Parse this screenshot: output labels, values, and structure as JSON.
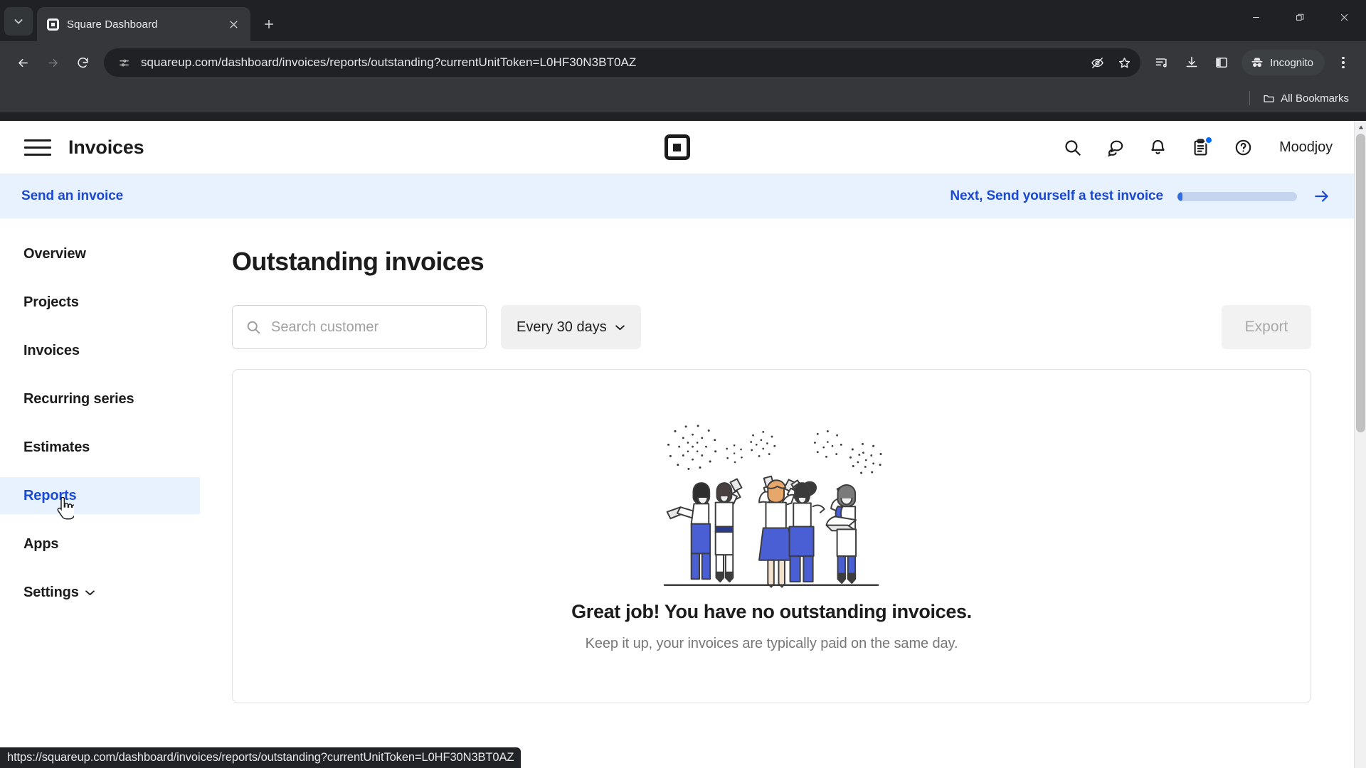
{
  "browser": {
    "tab": {
      "title": "Square Dashboard",
      "favicon": "square-logo-icon"
    },
    "tab_search_tooltip": "Search tabs",
    "new_tab_label": "New tab",
    "url": "squareup.com/dashboard/invoices/reports/outstanding?currentUnitToken=L0HF30N3BT0AZ",
    "profile_label": "Incognito",
    "bookmarks_label": "All Bookmarks",
    "status_url": "https://squareup.com/dashboard/invoices/reports/outstanding?currentUnitToken=L0HF30N3BT0AZ",
    "icons": {
      "back": "back-arrow-icon",
      "forward": "forward-arrow-icon",
      "reload": "reload-icon",
      "site_info": "site-settings-icon",
      "tracking": "eye-off-icon",
      "bookmark": "star-icon",
      "reading_list": "reading-list-icon",
      "downloads": "download-icon",
      "side_panel": "side-panel-icon",
      "menu": "three-dot-menu-icon",
      "minimize": "minimize-icon",
      "maximize": "restore-window-icon",
      "close": "close-window-icon"
    }
  },
  "app": {
    "header": {
      "menu_label": "Menu",
      "title": "Invoices",
      "logo": "square-logo-icon",
      "actions": [
        {
          "name": "search-icon",
          "label": "Search"
        },
        {
          "name": "messages-icon",
          "label": "Messages"
        },
        {
          "name": "notifications-bell-icon",
          "label": "Notifications"
        },
        {
          "name": "tasks-clipboard-icon",
          "label": "Tasks",
          "badge": true
        },
        {
          "name": "help-circle-icon",
          "label": "Help"
        }
      ],
      "user": "Moodjoy"
    },
    "banner": {
      "link": "Send an invoice",
      "next_text": "Next, Send yourself a test invoice",
      "progress_percent": 4,
      "arrow": "arrow-right-icon"
    },
    "sidebar": {
      "items": [
        {
          "label": "Overview",
          "active": false,
          "chevron": false
        },
        {
          "label": "Projects",
          "active": false,
          "chevron": false
        },
        {
          "label": "Invoices",
          "active": false,
          "chevron": false
        },
        {
          "label": "Recurring series",
          "active": false,
          "chevron": false
        },
        {
          "label": "Estimates",
          "active": false,
          "chevron": false
        },
        {
          "label": "Reports",
          "active": true,
          "chevron": false
        },
        {
          "label": "Apps",
          "active": false,
          "chevron": false
        },
        {
          "label": "Settings",
          "active": false,
          "chevron": true
        }
      ]
    },
    "main": {
      "title": "Outstanding invoices",
      "search_placeholder": "Search customer",
      "search_value": "",
      "period_select": "Every 30 days",
      "export_label": "Export",
      "export_disabled": true,
      "empty_state": {
        "illustration": "celebrating-people-confetti-illustration",
        "title": "Great job! You have no outstanding invoices.",
        "subtitle": "Keep it up, your invoices are typically paid on the same day."
      }
    }
  },
  "colors": {
    "accent_blue": "#1a49d4",
    "banner_bg": "#e8f1fe",
    "badge_blue": "#006aff",
    "illustration_blue": "#4a5fd4",
    "text_dark": "#1c1c1c",
    "text_muted": "#777777"
  }
}
